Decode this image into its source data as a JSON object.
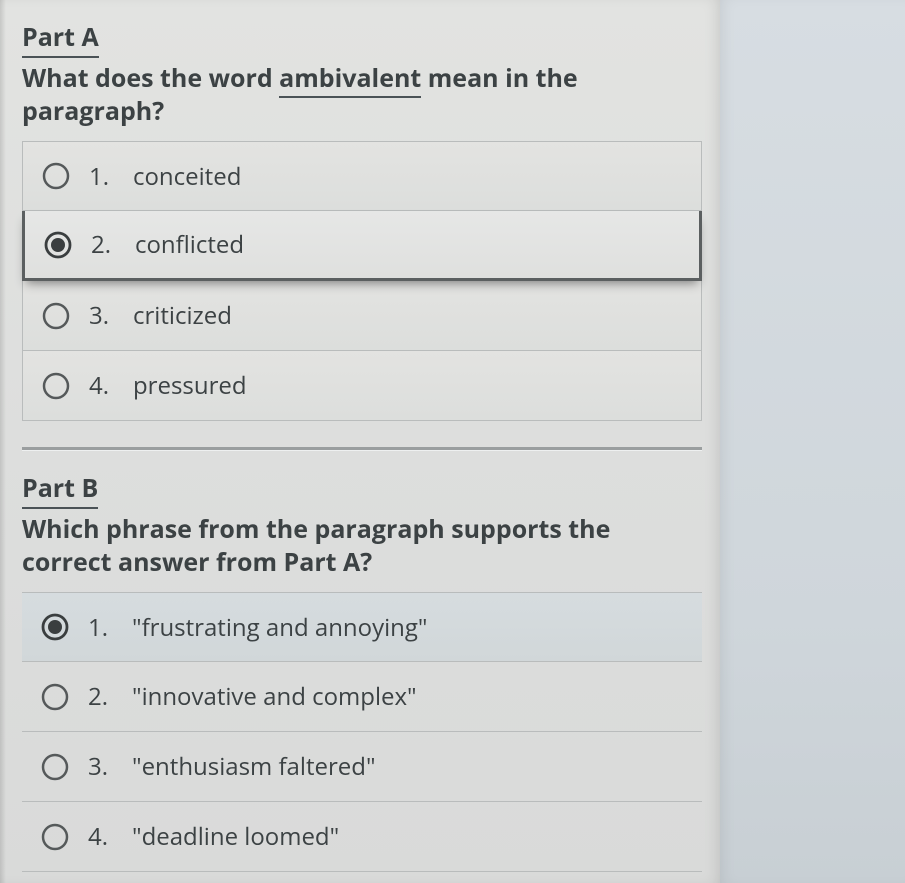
{
  "partA": {
    "label": "Part A",
    "question_pre": "What does the word ",
    "question_ul": "ambivalent",
    "question_post": " mean in the paragraph?",
    "options": [
      {
        "num": "1.",
        "text": "conceited",
        "selected": false
      },
      {
        "num": "2.",
        "text": "conflicted",
        "selected": true
      },
      {
        "num": "3.",
        "text": "criticized",
        "selected": false
      },
      {
        "num": "4.",
        "text": "pressured",
        "selected": false
      }
    ]
  },
  "partB": {
    "label": "Part B",
    "question": "Which phrase from the paragraph supports the correct answer from Part A?",
    "options": [
      {
        "num": "1.",
        "text": "\"frustrating and annoying\"",
        "selected": true
      },
      {
        "num": "2.",
        "text": "\"innovative and complex\"",
        "selected": false
      },
      {
        "num": "3.",
        "text": "\"enthusiasm faltered\"",
        "selected": false
      },
      {
        "num": "4.",
        "text": "\"deadline loomed\"",
        "selected": false
      }
    ]
  }
}
